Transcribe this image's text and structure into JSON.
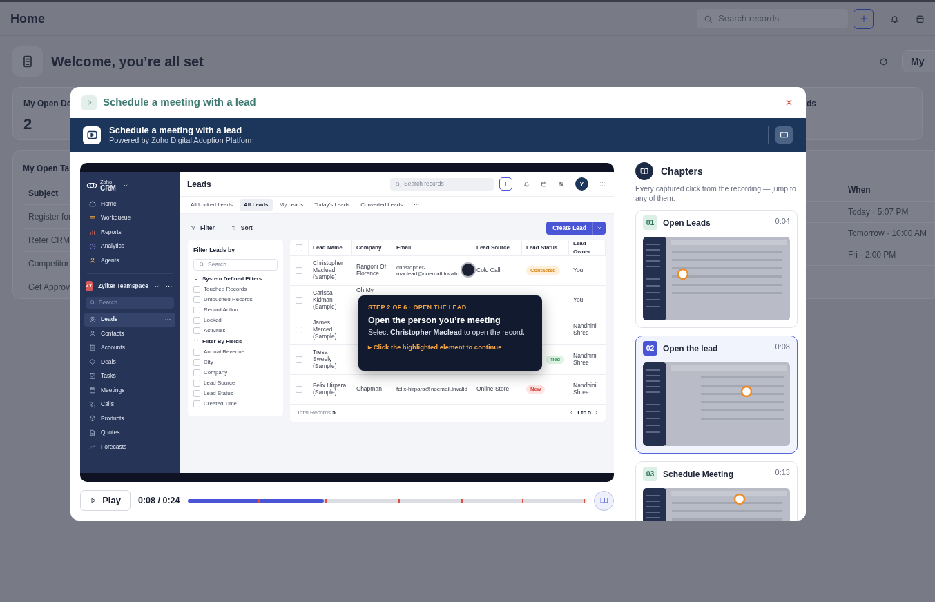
{
  "home": {
    "title": "Home",
    "search_placeholder": "Search records",
    "welcome": "Welcome, you’re all set",
    "view_button": "My",
    "stat_cards": [
      {
        "label": "My Open De",
        "value": "2"
      },
      {
        "label": "ds"
      }
    ],
    "tasks": {
      "title": "My Open Ta",
      "column_1": "Subject",
      "rows": [
        "Register for",
        "Refer CRM",
        "Competitor",
        "Get Approv"
      ]
    },
    "meetings": {
      "column_1": "When",
      "rows": [
        "Today · 5:07 PM",
        "Tomorrow · 10:00 AM",
        "Fri · 2:00 PM"
      ]
    }
  },
  "dialog": {
    "title": "Schedule a meeting with a lead",
    "banner_title": "Schedule a meeting with a lead",
    "banner_subtitle": "Powered by Zoho Digital Adoption Platform",
    "recording": {
      "logo_brand": "Zoho",
      "logo_product": "CRM",
      "nav": [
        {
          "label": "Home"
        },
        {
          "label": "Workqueue"
        },
        {
          "label": "Reports"
        },
        {
          "label": "Analytics"
        },
        {
          "label": "Agents"
        }
      ],
      "teamspace": {
        "badge": "ZY",
        "name": "Zylker Teamspace",
        "search_placeholder": "Search"
      },
      "modules": [
        {
          "label": "Leads",
          "selected": true
        },
        {
          "label": "Contacts",
          "selected": false
        },
        {
          "label": "Accounts",
          "selected": false
        },
        {
          "label": "Deals",
          "selected": false
        },
        {
          "label": "Tasks",
          "selected": false
        },
        {
          "label": "Meetings",
          "selected": false
        },
        {
          "label": "Calls",
          "selected": false
        },
        {
          "label": "Products",
          "selected": false
        },
        {
          "label": "Quotes",
          "selected": false
        },
        {
          "label": "Forecasts",
          "selected": false
        }
      ],
      "page_title": "Leads",
      "search_placeholder": "Search records",
      "avatar": "Y",
      "tabs": [
        {
          "label": "All Locked Leads",
          "selected": false
        },
        {
          "label": "All Leads",
          "selected": true
        },
        {
          "label": "My Leads",
          "selected": false
        },
        {
          "label": "Today’s Leads",
          "selected": false
        },
        {
          "label": "Converted Leads",
          "selected": false
        }
      ],
      "tabs_more": "···",
      "filter": "Filter",
      "sort": "Sort",
      "create_button": "Create Lead",
      "filter_panel": {
        "title": "Filter Leads by",
        "search_placeholder": "Search",
        "groups": [
          {
            "title": "System Defined Filters",
            "expanded": true,
            "items": [
              {
                "label": "Touched Records",
                "checked": false
              },
              {
                "label": "Untouched Records",
                "checked": false
              },
              {
                "label": "Record Action",
                "checked": false
              },
              {
                "label": "Locked",
                "checked": false
              },
              {
                "label": "Activities",
                "checked": false
              }
            ]
          },
          {
            "title": "Filter By Fields",
            "expanded": true,
            "items": [
              {
                "label": "Annual Revenue",
                "checked": false
              },
              {
                "label": "City",
                "checked": false
              },
              {
                "label": "Company",
                "checked": false
              },
              {
                "label": "Lead Source",
                "checked": false
              },
              {
                "label": "Lead Status",
                "checked": false
              },
              {
                "label": "Created Time",
                "checked": false
              }
            ]
          }
        ]
      },
      "table": {
        "select_all_checked": false,
        "columns": [
          "Lead Name",
          "Company",
          "Email",
          "Lead Source",
          "Lead Status",
          "Lead Owner"
        ],
        "rows": [
          {
            "checked": false,
            "name": "Christopher Maclead (Sample)",
            "company": "Rangoni Of Florence",
            "email": "christopher-maclead@noemail.invalid",
            "source": "Cold Call",
            "status": {
              "label": "Contacted",
              "kind": "contacted"
            },
            "owner": "You"
          },
          {
            "checked": false,
            "name": "Carissa Kidman (Sample)",
            "company": "Oh My",
            "owner": "You"
          },
          {
            "checked": false,
            "name": "James Merced (Sample)",
            "owner": "Nandhini Shree"
          },
          {
            "checked": false,
            "name": "Tresa Sweely (Sample)",
            "status": {
              "label": "ified",
              "kind": "qualified"
            },
            "owner": "Nandhini Shree"
          },
          {
            "checked": false,
            "name": "Felix Hirpara (Sample)",
            "company": "Chapman",
            "email": "felix-hirpara@noemail.invalid",
            "source": "Online Store",
            "status": {
              "label": "New",
              "kind": "new"
            },
            "owner": "Nandhini Shree"
          }
        ],
        "total_label": "Total Records",
        "total": "5",
        "pager": "1 to 5"
      },
      "tooltip": {
        "step": "STEP 2 OF 6 · OPEN THE LEAD",
        "title": "Open the person you’re meeting",
        "body": "Select **Christopher Maclead** to open the record.",
        "action": "▸ Click the highlighted element to continue"
      }
    },
    "player": {
      "button": "Play",
      "time": "0:08 / 0:24",
      "level": 0.34
    },
    "chapters": {
      "title": "Chapters",
      "description": "Every captured click from the recording — jump to any of them.",
      "items": [
        {
          "number": "01",
          "title": "Open Leads",
          "time": "0:04",
          "selected": false
        },
        {
          "number": "02",
          "title": "Open the lead",
          "time": "0:08",
          "selected": true
        },
        {
          "number": "03",
          "title": "Schedule Meeting",
          "time": "0:13",
          "selected": false
        }
      ]
    }
  }
}
